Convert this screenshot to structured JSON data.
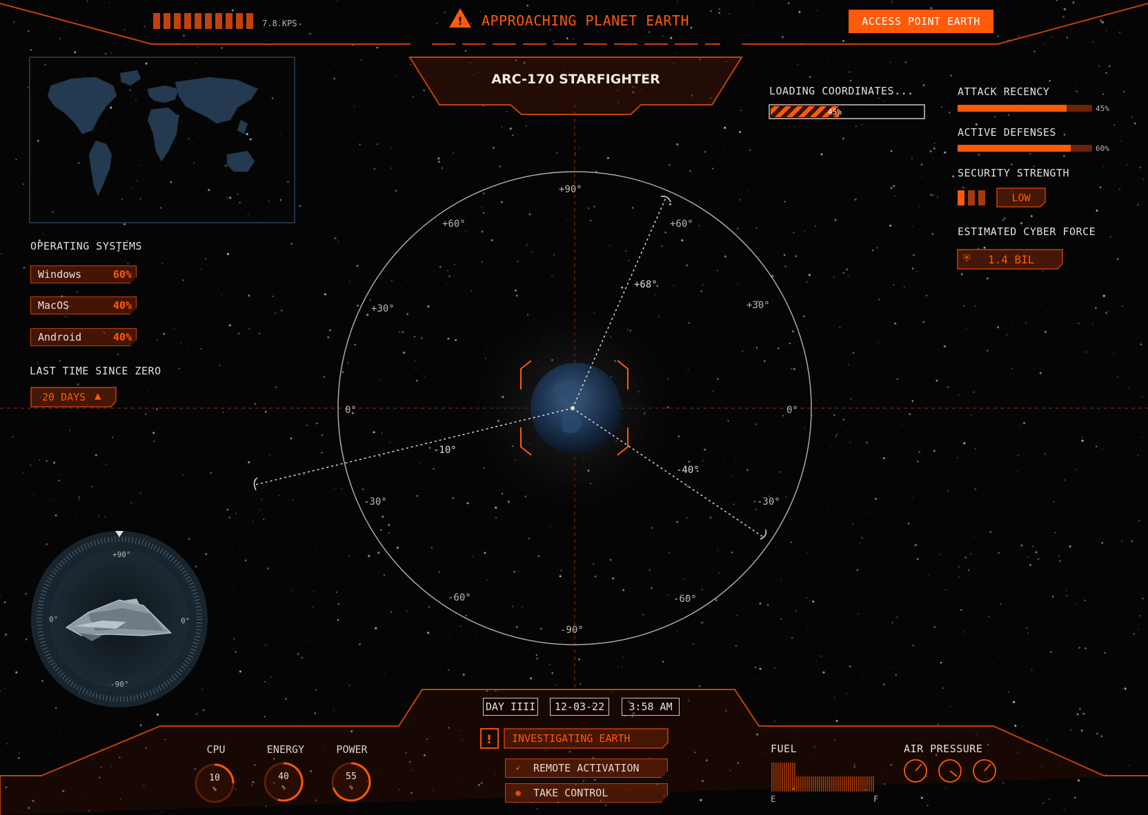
{
  "header": {
    "speed_label": "7.8 KPS",
    "alert_title": "APPROACHING PLANET EARTH",
    "access_button": "ACCESS POINT EARTH",
    "ship_name": "ARC-170 STARFIGHTER"
  },
  "loading": {
    "label": "LOADING COORDINATES...",
    "value_text": "45%",
    "value": 0.45
  },
  "right_panel": {
    "attack_recency": {
      "label": "ATTACK RECENCY",
      "value_text": "45%",
      "value": 0.45
    },
    "active_defenses": {
      "label": "ACTIVE DEFENSES",
      "value_text": "60%",
      "value": 0.6
    },
    "security_strength": {
      "label": "SECURITY STRENGTH",
      "level": "LOW"
    },
    "cyber_force": {
      "label": "ESTIMATED CYBER FORCE",
      "value": "1.4 BIL"
    }
  },
  "left_panel": {
    "os_title": "OPERATING SYSTEMS",
    "os": [
      {
        "name": "Windows",
        "pct": "60%"
      },
      {
        "name": "MacOS",
        "pct": "40%"
      },
      {
        "name": "Android",
        "pct": "40%"
      }
    ],
    "zero_title": "LAST TIME SINCE ZERO",
    "zero_value": "20 DAYS"
  },
  "radar": {
    "labels": {
      "top": "+90°",
      "bottom": "-90°",
      "left": "0°",
      "right": "0°",
      "ul60": "+60°",
      "ur60": "+60°",
      "ul30": "+30°",
      "ur30": "+30°",
      "ll30": "-30°",
      "lr30": "-30°",
      "ll60": "-60°",
      "lr60": "-60°",
      "p68": "+68°",
      "m10": "-10°",
      "m40": "-40°"
    }
  },
  "compass": {
    "top": "+90°",
    "bottom": "-90°",
    "left": "0°",
    "right": "0°"
  },
  "footer": {
    "day": "DAY IIII",
    "date": "12-03-22",
    "time": "3:58 AM",
    "status": "INVESTIGATING EARTH",
    "remote": "REMOTE ACTIVATION",
    "take_control": "TAKE CONTROL",
    "gauges": [
      {
        "label": "CPU",
        "value": "10",
        "unit": "%",
        "level": 0.1
      },
      {
        "label": "ENERGY",
        "value": "40",
        "unit": "%",
        "level": 0.4
      },
      {
        "label": "POWER",
        "value": "55",
        "unit": "%",
        "level": 0.55
      }
    ],
    "fuel": {
      "label": "FUEL",
      "empty": "E",
      "full": "F"
    },
    "air_pressure": {
      "label": "AIR PRESSURE"
    }
  },
  "colors": {
    "accent": "#ff5a0a",
    "accent_dark": "#7a2a08",
    "frame": "#c2420a",
    "background": "#050505"
  }
}
